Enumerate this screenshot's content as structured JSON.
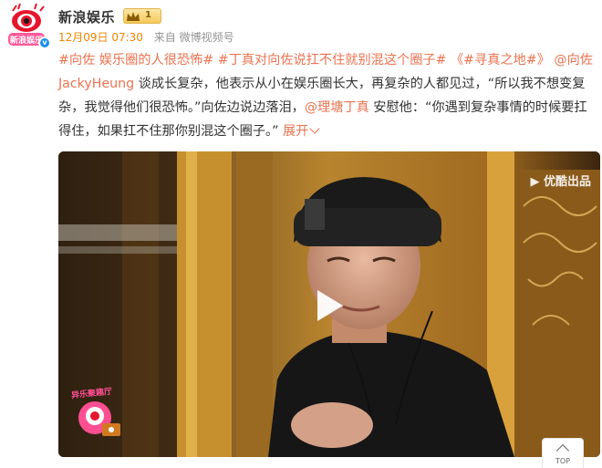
{
  "post": {
    "author": "新浪娱乐",
    "avatar_logo_text": "新浪娱乐",
    "verified_icon": "v-verified-badge-icon",
    "level_badge": {
      "icon": "crown-icon",
      "level": "1"
    },
    "timestamp": "12月09日 07:30",
    "source": "来自 微博视频号",
    "text": {
      "topic1": "#向佐 娱乐圈的人很恐怖#",
      "topic2": "#丁真对向佐说扛不住就别混这个圈子#",
      "book_title": "《#寻真之地#》",
      "mention1": "@向佐JackyHeung",
      "body1": " 谈成长复杂，他表示从小在娱乐圈长大，再复杂的人都见过，“所以我不想变复杂，我觉得他们很恐怖。”向佐边说边落泪，",
      "mention2": "@理塘丁真",
      "body2": " 安慰他：“你遇到复杂事情的时候要扛得住，如果扛不住那你别混这个圈子。”",
      "expand": "展开"
    }
  },
  "video": {
    "watermark": "优酷出品",
    "play_icon": "play-icon",
    "show_logo_text": "异乐聚趣厅"
  },
  "top_button": {
    "label": "TOP"
  },
  "colors": {
    "link": "#eb7350",
    "timestamp": "#f08300",
    "meta": "#939393"
  }
}
